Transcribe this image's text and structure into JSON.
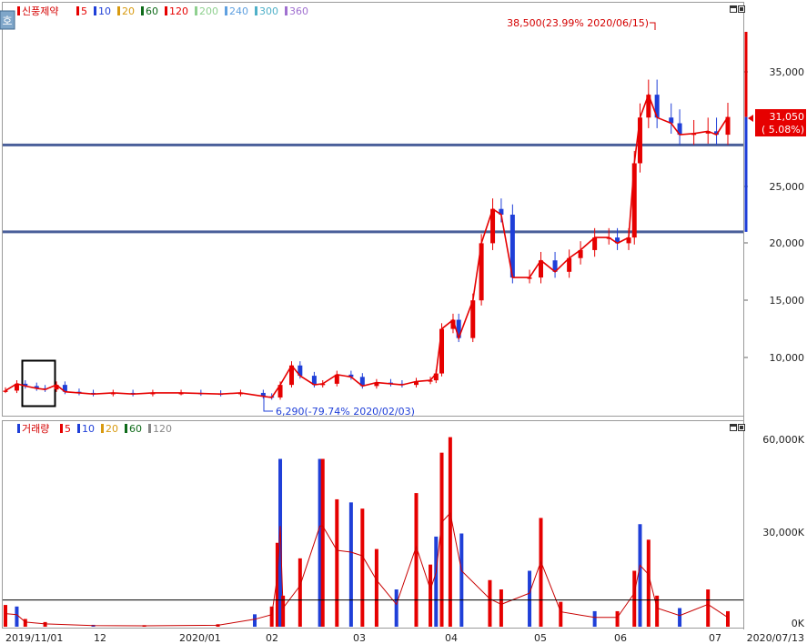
{
  "toolbar": {
    "mode_icon": "호"
  },
  "price_panel": {
    "legend_stock": "신풍제약",
    "ma_legend": [
      {
        "label": "5",
        "color": "#e60000"
      },
      {
        "label": "10",
        "color": "#1f3fd8"
      },
      {
        "label": "20",
        "color": "#d89a10"
      },
      {
        "label": "60",
        "color": "#0f6b1a"
      },
      {
        "label": "120",
        "color": "#e60000"
      },
      {
        "label": "200",
        "color": "#8fd08f"
      },
      {
        "label": "240",
        "color": "#5fa0e0"
      },
      {
        "label": "300",
        "color": "#4fb0c8"
      },
      {
        "label": "360",
        "color": "#a070d0"
      }
    ],
    "high_annotation": "38,500(23.99% 2020/06/15)",
    "low_annotation": "6,290(-79.74% 2020/02/03)",
    "current_price": "31,050",
    "current_change": "( 5.08%)",
    "y_ticks": [
      "35,000",
      "25,000",
      "20,000",
      "15,000",
      "10,000"
    ]
  },
  "volume_panel": {
    "legend_title": "거래량",
    "ma_legend": [
      {
        "label": "5",
        "color": "#e60000"
      },
      {
        "label": "10",
        "color": "#1f3fd8"
      },
      {
        "label": "20",
        "color": "#d89a10"
      },
      {
        "label": "60",
        "color": "#0f6b1a"
      },
      {
        "label": "120",
        "color": "#888888"
      }
    ],
    "y_ticks": [
      "60,000K",
      "30,000K",
      "0K"
    ]
  },
  "x_axis": {
    "labels": [
      "2019/11/01",
      "12",
      "2020/01",
      "02",
      "03",
      "04",
      "05",
      "06",
      "07"
    ],
    "end_label": "2020/07/13"
  },
  "chart_data": [
    {
      "type": "candlestick",
      "title": "신풍제약",
      "x_range": [
        "2019/11/01",
        "2020/07/13"
      ],
      "ylim": [
        5000,
        40000
      ],
      "y_ticks": [
        10000,
        15000,
        20000,
        25000,
        35000
      ],
      "annotations": [
        {
          "label": "38,500(23.99% 2020/06/15)",
          "date": "2020/06/15",
          "value": 38500
        },
        {
          "label": "6,290(-79.74% 2020/02/03)",
          "date": "2020/02/03",
          "value": 6290
        }
      ],
      "current": {
        "value": 31050,
        "change_pct": 5.08
      },
      "horizontal_lines": [
        28600,
        21000
      ],
      "close_series": [
        {
          "date": "2019/11/01",
          "close": 7100
        },
        {
          "date": "2019/11/05",
          "close": 7700
        },
        {
          "date": "2019/11/08",
          "close": 7500
        },
        {
          "date": "2019/11/12",
          "close": 7300
        },
        {
          "date": "2019/11/15",
          "close": 7200
        },
        {
          "date": "2019/11/19",
          "close": 7600
        },
        {
          "date": "2019/11/22",
          "close": 7000
        },
        {
          "date": "2019/11/27",
          "close": 6900
        },
        {
          "date": "2019/12/02",
          "close": 6800
        },
        {
          "date": "2019/12/09",
          "close": 6900
        },
        {
          "date": "2019/12/16",
          "close": 6800
        },
        {
          "date": "2019/12/23",
          "close": 6900
        },
        {
          "date": "2020/01/02",
          "close": 6900
        },
        {
          "date": "2020/01/09",
          "close": 6850
        },
        {
          "date": "2020/01/16",
          "close": 6800
        },
        {
          "date": "2020/01/23",
          "close": 6900
        },
        {
          "date": "2020/01/31",
          "close": 6600
        },
        {
          "date": "2020/02/03",
          "close": 6500
        },
        {
          "date": "2020/02/06",
          "close": 7600
        },
        {
          "date": "2020/02/10",
          "close": 9300
        },
        {
          "date": "2020/02/13",
          "close": 8400
        },
        {
          "date": "2020/02/18",
          "close": 7600
        },
        {
          "date": "2020/02/21",
          "close": 7700
        },
        {
          "date": "2020/02/26",
          "close": 8500
        },
        {
          "date": "2020/03/02",
          "close": 8300
        },
        {
          "date": "2020/03/06",
          "close": 7500
        },
        {
          "date": "2020/03/11",
          "close": 7800
        },
        {
          "date": "2020/03/16",
          "close": 7700
        },
        {
          "date": "2020/03/20",
          "close": 7600
        },
        {
          "date": "2020/03/25",
          "close": 7900
        },
        {
          "date": "2020/03/30",
          "close": 8000
        },
        {
          "date": "2020/04/01",
          "close": 8600
        },
        {
          "date": "2020/04/03",
          "close": 12500
        },
        {
          "date": "2020/04/07",
          "close": 13300
        },
        {
          "date": "2020/04/09",
          "close": 11700
        },
        {
          "date": "2020/04/14",
          "close": 15000
        },
        {
          "date": "2020/04/17",
          "close": 20000
        },
        {
          "date": "2020/04/21",
          "close": 23000
        },
        {
          "date": "2020/04/24",
          "close": 22500
        },
        {
          "date": "2020/04/28",
          "close": 17000
        },
        {
          "date": "2020/05/04",
          "close": 17000
        },
        {
          "date": "2020/05/08",
          "close": 18500
        },
        {
          "date": "2020/05/13",
          "close": 17500
        },
        {
          "date": "2020/05/18",
          "close": 18700
        },
        {
          "date": "2020/05/22",
          "close": 19400
        },
        {
          "date": "2020/05/27",
          "close": 20500
        },
        {
          "date": "2020/06/01",
          "close": 20500
        },
        {
          "date": "2020/06/04",
          "close": 20000
        },
        {
          "date": "2020/06/08",
          "close": 20500
        },
        {
          "date": "2020/06/10",
          "close": 27000
        },
        {
          "date": "2020/06/12",
          "close": 31000
        },
        {
          "date": "2020/06/15",
          "close": 33000
        },
        {
          "date": "2020/06/18",
          "close": 31000
        },
        {
          "date": "2020/06/23",
          "close": 30500
        },
        {
          "date": "2020/06/26",
          "close": 29500
        },
        {
          "date": "2020/07/01",
          "close": 29600
        },
        {
          "date": "2020/07/06",
          "close": 29800
        },
        {
          "date": "2020/07/09",
          "close": 29500
        },
        {
          "date": "2020/07/13",
          "close": 31050
        }
      ]
    },
    {
      "type": "bar",
      "title": "거래량",
      "unit": "K",
      "ylim": [
        0,
        66000
      ],
      "y_ticks": [
        0,
        30000,
        60000
      ],
      "series": [
        {
          "name": "거래량",
          "values": [
            {
              "date": "2019/11/01",
              "value": 7000
            },
            {
              "date": "2019/11/05",
              "value": 6500
            },
            {
              "date": "2019/11/08",
              "value": 2500
            },
            {
              "date": "2019/11/15",
              "value": 1500
            },
            {
              "date": "2019/12/02",
              "value": 600
            },
            {
              "date": "2019/12/20",
              "value": 500
            },
            {
              "date": "2020/01/15",
              "value": 800
            },
            {
              "date": "2020/01/28",
              "value": 4000
            },
            {
              "date": "2020/02/03",
              "value": 6500
            },
            {
              "date": "2020/02/05",
              "value": 27000
            },
            {
              "date": "2020/02/06",
              "value": 54000
            },
            {
              "date": "2020/02/07",
              "value": 10000
            },
            {
              "date": "2020/02/13",
              "value": 22000
            },
            {
              "date": "2020/02/20",
              "value": 54000
            },
            {
              "date": "2020/02/21",
              "value": 54000
            },
            {
              "date": "2020/02/26",
              "value": 41000
            },
            {
              "date": "2020/03/02",
              "value": 40000
            },
            {
              "date": "2020/03/06",
              "value": 38000
            },
            {
              "date": "2020/03/11",
              "value": 25000
            },
            {
              "date": "2020/03/18",
              "value": 12000
            },
            {
              "date": "2020/03/25",
              "value": 43000
            },
            {
              "date": "2020/03/30",
              "value": 20000
            },
            {
              "date": "2020/04/01",
              "value": 29000
            },
            {
              "date": "2020/04/03",
              "value": 56000
            },
            {
              "date": "2020/04/06",
              "value": 61000
            },
            {
              "date": "2020/04/10",
              "value": 30000
            },
            {
              "date": "2020/04/20",
              "value": 15000
            },
            {
              "date": "2020/04/24",
              "value": 12000
            },
            {
              "date": "2020/05/04",
              "value": 18000
            },
            {
              "date": "2020/05/08",
              "value": 35000
            },
            {
              "date": "2020/05/15",
              "value": 8000
            },
            {
              "date": "2020/05/27",
              "value": 5000
            },
            {
              "date": "2020/06/04",
              "value": 5000
            },
            {
              "date": "2020/06/10",
              "value": 18000
            },
            {
              "date": "2020/06/12",
              "value": 33000
            },
            {
              "date": "2020/06/15",
              "value": 28000
            },
            {
              "date": "2020/06/18",
              "value": 10000
            },
            {
              "date": "2020/06/26",
              "value": 6000
            },
            {
              "date": "2020/07/06",
              "value": 12000
            },
            {
              "date": "2020/07/13",
              "value": 5000
            }
          ]
        }
      ],
      "horizontal_lines": [
        8600
      ]
    }
  ]
}
